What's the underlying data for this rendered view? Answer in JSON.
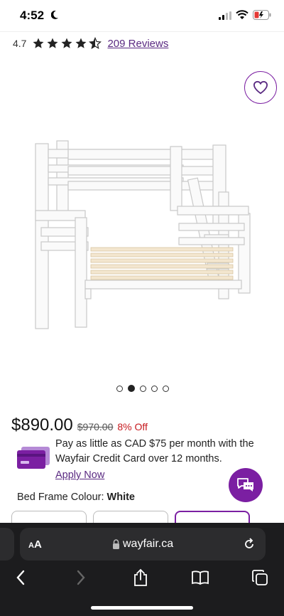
{
  "status_bar": {
    "time": "4:52"
  },
  "product": {
    "rating": "4.7",
    "stars_filled": 4.5,
    "reviews_label": "209 Reviews",
    "carousel": {
      "total": 5,
      "active_index": 1
    },
    "price_current": "$890.00",
    "price_old": "$970.00",
    "discount": "8% Off",
    "credit_offer": "Pay as little as CAD $75 per month with the Wayfair Credit Card over 12 months.",
    "apply_label": "Apply Now",
    "colour_label": "Bed Frame Colour:",
    "colour_value": "White"
  },
  "browser": {
    "aa_label_small": "A",
    "aa_label_large": "A",
    "url": "wayfair.ca"
  },
  "colors": {
    "brand_purple": "#7b1fa2",
    "link_purple": "#5a2a82",
    "discount_red": "#c6181d"
  },
  "icons": [
    "moon-icon",
    "signal-icon",
    "wifi-icon",
    "battery-icon",
    "star-icon",
    "heart-icon",
    "credit-card-icon",
    "chat-icon",
    "lock-icon",
    "reload-icon",
    "back-icon",
    "forward-icon",
    "share-icon",
    "bookmarks-icon",
    "tabs-icon"
  ]
}
